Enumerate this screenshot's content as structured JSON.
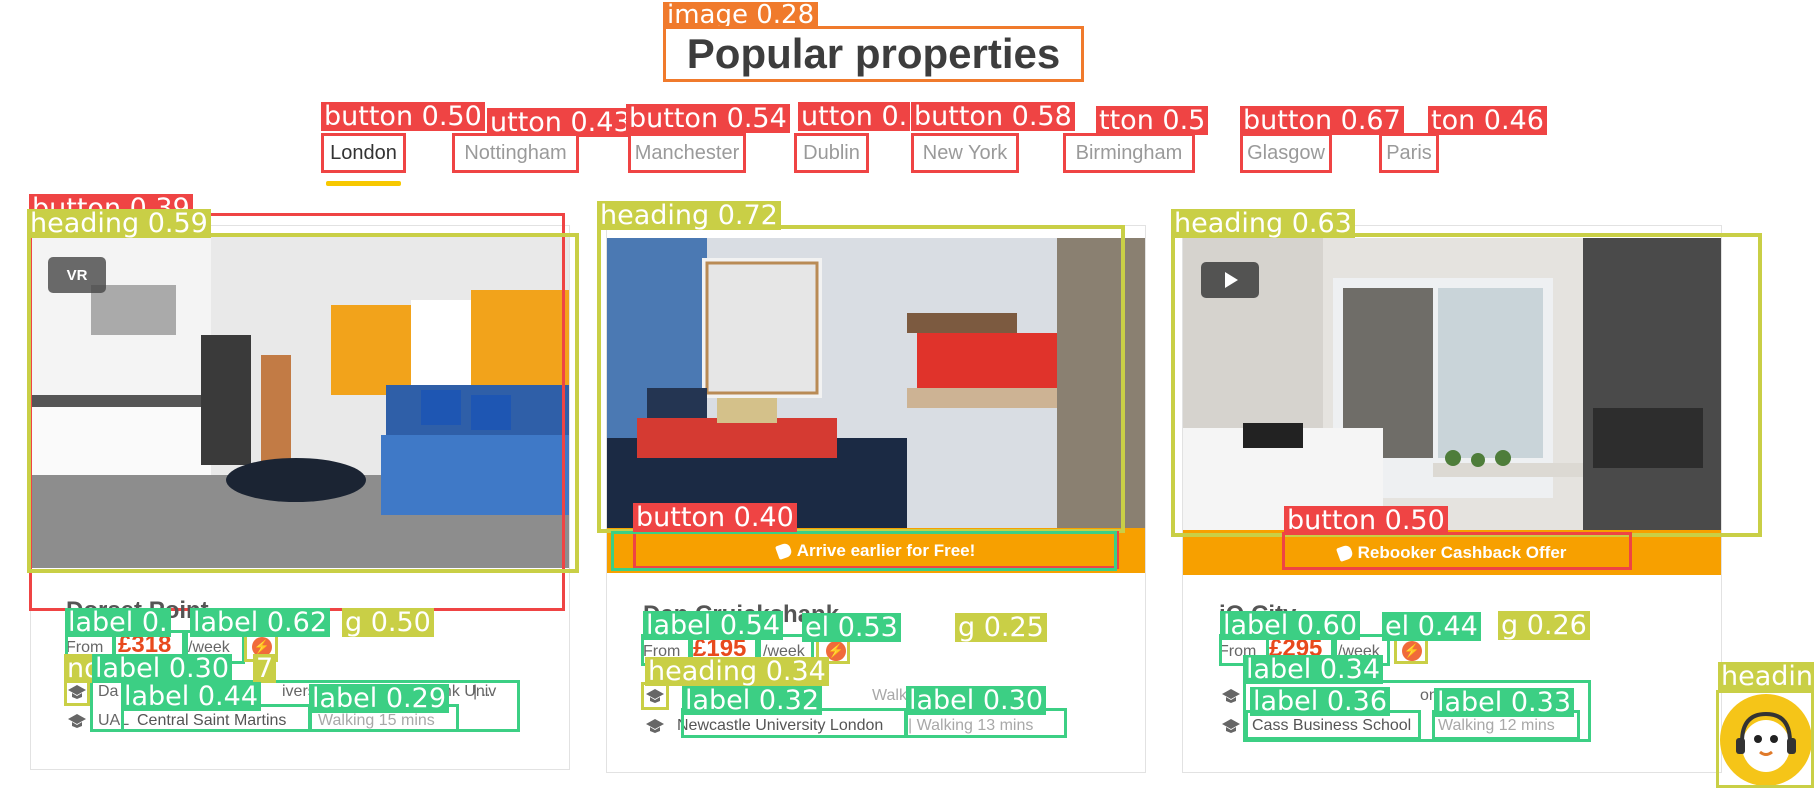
{
  "title_tag": "image 0.28",
  "page_title": "Popular properties",
  "tabs": [
    {
      "label": "London",
      "tag": "button 0.50"
    },
    {
      "label": "Nottingham",
      "tag": "utton 0.43"
    },
    {
      "label": "Manchester",
      "tag": "button 0.54"
    },
    {
      "label": "Dublin",
      "tag": "utton 0."
    },
    {
      "label": "New York",
      "tag": "button 0.58"
    },
    {
      "label": "Birmingham",
      "tag": "tton 0.5"
    },
    {
      "label": "Glasgow",
      "tag": "button 0.67"
    },
    {
      "label": "Paris",
      "tag": "ton 0.46"
    }
  ],
  "cards": [
    {
      "button_tag": "button 0.39",
      "heading_tag": "heading 0.59",
      "name": "Dorset Point",
      "from_label": "From",
      "price": "£318",
      "per": "/week",
      "label_tags": [
        "label 0.",
        "label 0.62",
        "g 0.50",
        "no",
        "label 0.30",
        "7",
        "label 0.44",
        "label 0.29"
      ],
      "school1": "Da",
      "school1_tail": "ivers",
      "school1_mid": "h Bank Univ",
      "ellipsis": "| ...",
      "school2_prefix": "UAL",
      "school2": "Central Saint Martins",
      "walk2": "Walking 15 mins",
      "badge": "VR"
    },
    {
      "button_tag": "button 0.40",
      "heading_tag": "heading 0.72",
      "promo": "Arrive earlier for Free!",
      "name": "Dan Cruickshank",
      "from_label": "From",
      "price": "£195",
      "per": "/week",
      "label_tags": [
        "label 0.54",
        "el 0.53",
        "g 0.25",
        "heading 0.34",
        "label 0.32",
        "label 0.30"
      ],
      "walk1": "Walking 9",
      "school2": "Newcastle University London",
      "walk2": "| Walking 13 mins"
    },
    {
      "button_tag": "button 0.50",
      "heading_tag": "heading 0.63",
      "promo": "Rebooker Cashback Offer",
      "name": "iQ City",
      "from_label": "From",
      "price": "£295",
      "per": "/week",
      "label_tags": [
        "label 0.60",
        "el 0.44",
        "g 0.26",
        "label 0.34",
        "label 0.36",
        "label 0.33"
      ],
      "school1_mid": "on",
      "school2": "Cass Business School",
      "walk2": "Walking 12 mins"
    }
  ],
  "side_tag": "headin",
  "colors": {
    "tag_red": "#ef4444",
    "tag_yellow": "#c9cf46",
    "tag_green": "#3ccf84",
    "promo": "#f7a000",
    "price": "#e8491d",
    "accent": "#f7c800"
  }
}
